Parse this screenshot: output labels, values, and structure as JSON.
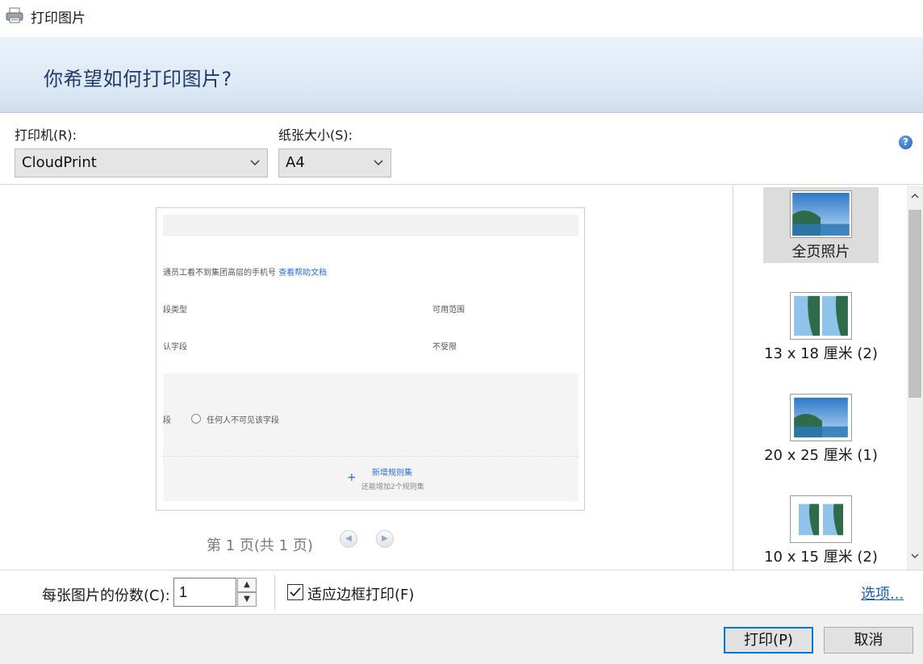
{
  "window": {
    "title": "打印图片"
  },
  "header": {
    "question": "你希望如何打印图片?"
  },
  "printer": {
    "label": "打印机(R):",
    "value": "CloudPrint"
  },
  "paper": {
    "label": "纸张大小(S):",
    "value": "A4"
  },
  "preview": {
    "line1": "通员工看不到集团高层的手机号",
    "line1_link": "查看帮助文档",
    "field_type": "段类型",
    "scope": "可用范围",
    "default_field": "认字段",
    "unlimited": "不受限",
    "field": "段",
    "radio_label": "任何人不可见该字段",
    "add_rule": "新增规则集",
    "add_rule_hint": "还能增加2个规则集",
    "page_indicator": "第 1 页(共 1 页)",
    "prev_glyph": "◀",
    "next_glyph": "▶"
  },
  "layouts": [
    {
      "label": "全页照片",
      "selected": true,
      "thumb": "full-page-photo"
    },
    {
      "label": "13 x 18 厘米 (2)",
      "selected": false,
      "thumb": "two-photos"
    },
    {
      "label": "20 x 25 厘米 (1)",
      "selected": false,
      "thumb": "one-photo"
    },
    {
      "label": "10 x 15 厘米 (2)",
      "selected": false,
      "thumb": "two-photos"
    }
  ],
  "copies": {
    "label": "每张图片的份数(C):",
    "value": "1"
  },
  "fit": {
    "label": "适应边框打印(F)",
    "checked": true
  },
  "options_link": "选项...",
  "buttons": {
    "print": "打印(P)",
    "cancel": "取消"
  },
  "colors": {
    "accent": "#0078d7",
    "header_text": "#1f3a6b",
    "link": "#1a5fb4"
  }
}
